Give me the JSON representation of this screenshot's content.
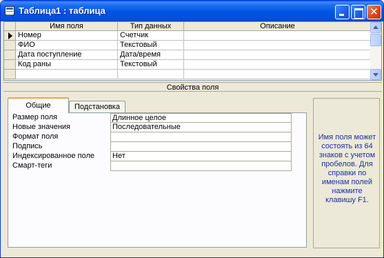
{
  "window": {
    "title": "Таблица1 : таблица"
  },
  "grid": {
    "headers": [
      "Имя поля",
      "Тип данных",
      "Описание"
    ],
    "rows": [
      {
        "name": "Номер",
        "type": "Счетчик",
        "description": "",
        "current": true
      },
      {
        "name": "ФИО",
        "type": "Текстовый",
        "description": ""
      },
      {
        "name": "Дата поступление",
        "type": "Дата/время",
        "description": ""
      },
      {
        "name": "Код раны",
        "type": "Текстовый",
        "description": ""
      },
      {
        "name": "",
        "type": "",
        "description": ""
      }
    ]
  },
  "properties": {
    "section_title": "Свойства поля",
    "tabs": [
      "Общие",
      "Подстановка"
    ],
    "active_tab": "Общие",
    "fields": [
      {
        "label": "Размер поля",
        "value": "Длинное целое"
      },
      {
        "label": "Новые значения",
        "value": "Последовательные"
      },
      {
        "label": "Формат поля",
        "value": ""
      },
      {
        "label": "Подпись",
        "value": ""
      },
      {
        "label": "Индексированное поле",
        "value": "Нет"
      },
      {
        "label": "Смарт-теги",
        "value": ""
      }
    ]
  },
  "help": {
    "text": "Имя поля может состоять из 64 знаков с учетом пробелов. Для справки по именам полей нажмите клавишу F1.",
    "color": "#1b2ea6"
  },
  "icons": {
    "window": "table-icon",
    "minimize": "minimize-icon",
    "maximize": "maximize-icon",
    "close": "close-icon",
    "row_selector": "current-row-arrow-icon"
  }
}
